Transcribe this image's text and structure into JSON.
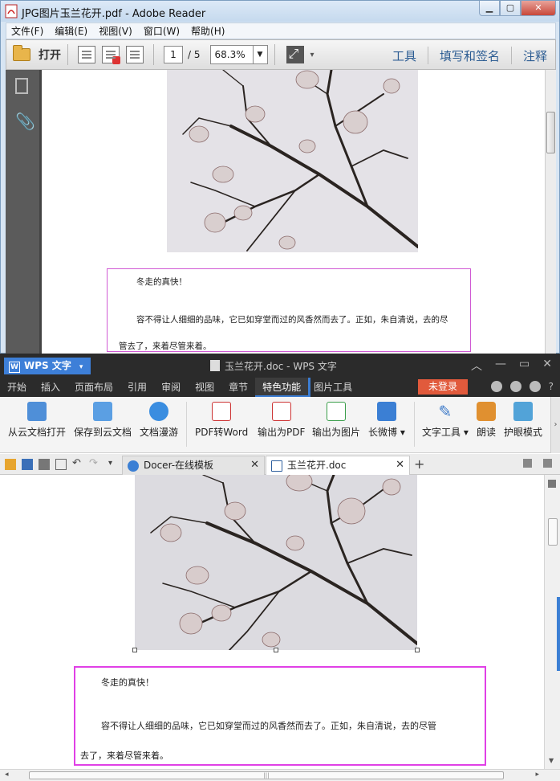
{
  "reader": {
    "title": "JPG图片玉兰花开.pdf - Adobe Reader",
    "menus": [
      "文件(F)",
      "编辑(E)",
      "视图(V)",
      "窗口(W)",
      "帮助(H)"
    ],
    "open_label": "打开",
    "page_current": "1",
    "page_total": "/ 5",
    "zoom": "68.3%",
    "right_tools": [
      "工具",
      "填写和签名",
      "注释"
    ],
    "doc": {
      "line1": "冬走的真快！",
      "line2": "容不得让人细细的品味，它已如穿堂而过的风香然而去了。正如，朱自清说，去的尽",
      "line3": "管去了，来着尽管来着。"
    }
  },
  "wps": {
    "logo": "WPS 文字",
    "title": "玉兰花开.doc - WPS 文字",
    "tabs": [
      "开始",
      "插入",
      "页面布局",
      "引用",
      "审阅",
      "视图",
      "章节",
      "特色功能",
      "图片工具"
    ],
    "login": "未登录",
    "help": "?",
    "ribbon": {
      "open_cloud": "从云文档打开",
      "save_cloud": "保存到云文档",
      "roam": "文档漫游",
      "pdf_to_word": "PDF转Word",
      "export_pdf": "输出为PDF",
      "export_image": "输出为图片",
      "weibo": "长微博",
      "text_tools": "文字工具",
      "read_aloud": "朗读",
      "eye_mode": "护眼模式"
    },
    "doc_tabs": [
      {
        "label": "Docer-在线模板"
      },
      {
        "label": "玉兰花开.doc"
      }
    ],
    "doc": {
      "line1": "冬走的真快！",
      "line2": "容不得让人细细的品味，它已如穿堂而过的风香然而去了。正如，朱自清说，去的尽管",
      "line3": "去了，来着尽管来着。"
    },
    "colors": {
      "accent": "#3b7fd4",
      "login": "#e15a3c",
      "textbox_border": "#e040e6"
    }
  }
}
